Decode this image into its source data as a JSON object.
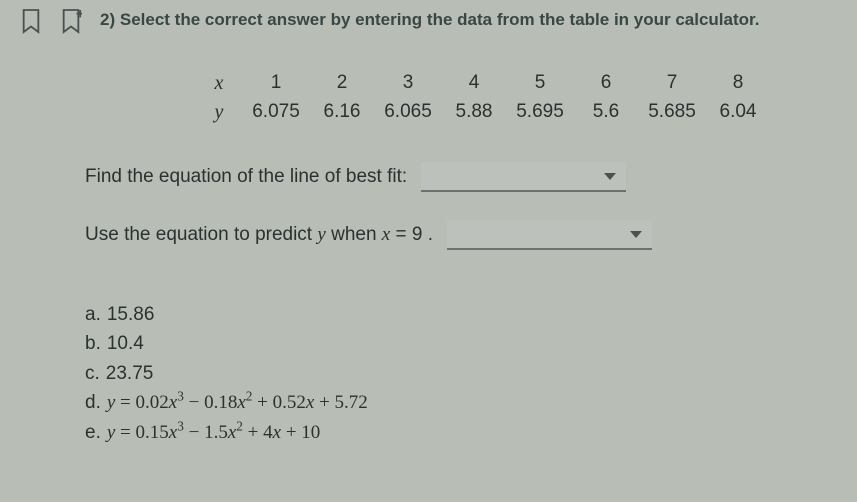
{
  "question": {
    "number": "2)",
    "prompt": "Select the correct answer by entering the data from the table in your calculator."
  },
  "table": {
    "row_labels": {
      "x": "x",
      "y": "y"
    },
    "x": [
      "1",
      "2",
      "3",
      "4",
      "5",
      "6",
      "7",
      "8"
    ],
    "y": [
      "6.075",
      "6.16",
      "6.065",
      "5.88",
      "5.695",
      "5.6",
      "5.685",
      "6.04"
    ]
  },
  "prompts": {
    "line1": "Find the equation of the line of best fit:",
    "line2_pre": "Use the equation to predict ",
    "line2_y": "y",
    "line2_mid": " when ",
    "line2_x": "x",
    "line2_post": " = 9 ."
  },
  "options": {
    "a": {
      "label": "a.",
      "text": "15.86"
    },
    "b": {
      "label": "b.",
      "text": "10.4"
    },
    "c": {
      "label": "c.",
      "text": "23.75"
    },
    "d": {
      "label": "d.",
      "y": "y",
      "eq": " = 0.02",
      "x1": "x",
      "p1": "3",
      "t2": " − 0.18",
      "x2": "x",
      "p2": "2",
      "t3": " + 0.52",
      "x3": "x",
      "t4": " + 5.72"
    },
    "e": {
      "label": "e.",
      "y": "y",
      "eq": " = 0.15",
      "x1": "x",
      "p1": "3",
      "t2": " − 1.5",
      "x2": "x",
      "p2": "2",
      "t3": " + 4",
      "x3": "x",
      "t4": " + 10"
    }
  }
}
